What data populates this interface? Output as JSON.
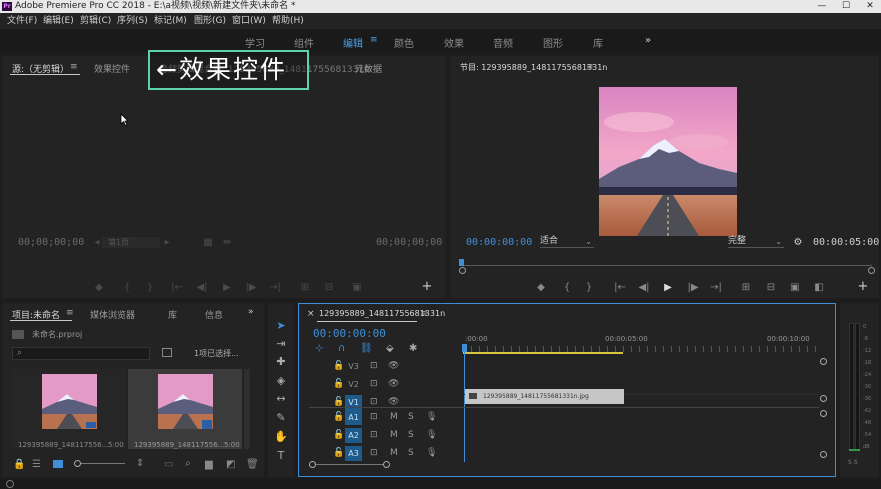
{
  "titlebar": {
    "logo": "Pr",
    "text": "Adobe Premiere Pro CC 2018 - E:\\a视频\\视频\\新建文件夹\\未命名 *",
    "min": "—",
    "max": "☐",
    "close": "✕"
  },
  "menu": [
    "文件(F)",
    "编辑(E)",
    "剪辑(C)",
    "序列(S)",
    "标记(M)",
    "图形(G)",
    "窗口(W)",
    "帮助(H)"
  ],
  "workspaces": {
    "items": [
      "学习",
      "组件",
      "编辑",
      "颜色",
      "效果",
      "音频",
      "图形",
      "库"
    ],
    "active": "编辑",
    "more": "»",
    "menu_icon": "≡"
  },
  "source_panel": {
    "tabs": [
      "源:（无剪辑）",
      "效果控件",
      "音频剪辑混合器: 129395889_14811755681331n",
      "元数据"
    ],
    "timecode_left": "00;00;00;00",
    "timecode_right": "00;00;00;00",
    "page_label": "第1页"
  },
  "annotation": {
    "text": "←效果控件",
    "border_color": "#5fd3a8"
  },
  "program_panel": {
    "title": "节目: 129395889_14811755681331n",
    "timecode_left": "00:00:00:00",
    "timecode_right": "00:00:05:00",
    "fit": "适合",
    "quality": "完整"
  },
  "project_panel": {
    "tabs": [
      "项目:未命名",
      "媒体浏览器",
      "库",
      "信息"
    ],
    "more": "»",
    "file": "未命名.prproj",
    "search_placeholder": "",
    "selected_info": "1项已选择...",
    "items": [
      {
        "name": "129395889_14811755681331n.jpg",
        "label": "129395889_148117556...",
        "duration": "5:00"
      },
      {
        "name": "129395889_14811755681331n",
        "label": "129395889_148117556...",
        "duration": "5:00"
      }
    ]
  },
  "timeline": {
    "close": "×",
    "sequence_name": "129395889_14811755681331n",
    "timecode": "00:00:00:00",
    "ruler": [
      ":00:00",
      "00:00:05:00",
      "00:00:10:00"
    ],
    "video_tracks": [
      "V3",
      "V2",
      "V1"
    ],
    "audio_tracks": [
      "A1",
      "A2",
      "A3"
    ],
    "clip_name": "129395889_14811755681331n.jpg",
    "mute": "M",
    "solo": "S"
  },
  "audio_meter": {
    "labels": [
      "0",
      "-6",
      "-12",
      "-18",
      "-24",
      "-30",
      "-36",
      "-42",
      "-48",
      "-54",
      "dB"
    ],
    "solo_labels": "S S"
  },
  "icons": {
    "play": "▶",
    "step_back": "◀|",
    "step_fwd": "|▶",
    "mark_in": "{",
    "mark_out": "}",
    "goto_in": "{←",
    "goto_out": "→}",
    "marker": "◆",
    "plus": "+",
    "wrench": "🔧",
    "camera": "▣",
    "lift": "⇪",
    "extract": "⇩"
  },
  "colors": {
    "accent": "#3f8fd8",
    "clip": "#c6c6c6",
    "playhead": "#4d9fe6",
    "track_on": "#1e5a8a"
  }
}
